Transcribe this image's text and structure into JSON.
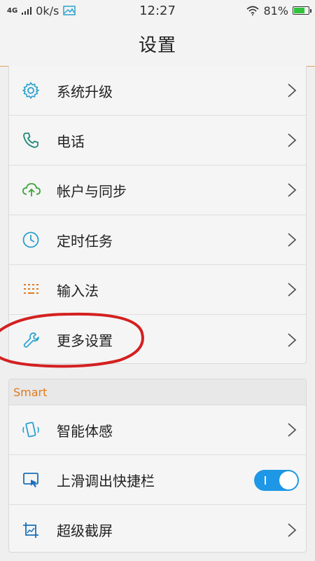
{
  "status_bar": {
    "network": "4G",
    "speed": "0k/s",
    "time": "12:27",
    "battery_percent": "81%",
    "battery_level": 0.81
  },
  "header": {
    "title": "设置"
  },
  "settings_list": {
    "items": [
      {
        "label": "系统升级",
        "icon": "gear-icon"
      },
      {
        "label": "电话",
        "icon": "phone-icon"
      },
      {
        "label": "帐户与同步",
        "icon": "cloud-sync-icon"
      },
      {
        "label": "定时任务",
        "icon": "clock-icon"
      },
      {
        "label": "输入法",
        "icon": "keyboard-icon"
      },
      {
        "label": "更多设置",
        "icon": "wrench-icon"
      }
    ]
  },
  "smart_section": {
    "header": "Smart",
    "items": [
      {
        "label": "智能体感",
        "icon": "phone-gesture-icon"
      },
      {
        "label": "上滑调出快捷栏",
        "icon": "quick-bar-icon",
        "toggle_on": true
      },
      {
        "label": "超级截屏",
        "icon": "screenshot-icon"
      }
    ]
  },
  "colors": {
    "accent_orange": "#e07a1f",
    "icon_blue": "#2aa1cf",
    "icon_green": "#3aa63a",
    "toggle_blue": "#1e97e6",
    "annotation_red": "#d42020"
  }
}
